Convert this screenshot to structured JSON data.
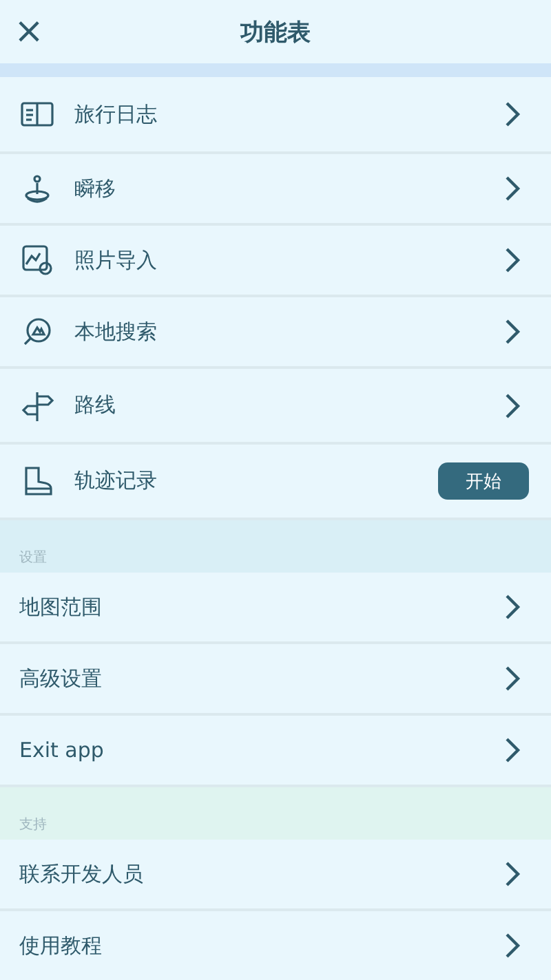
{
  "header": {
    "close": "×",
    "title": "功能表"
  },
  "features": [
    {
      "label": "旅行日志",
      "kind": "nav"
    },
    {
      "label": "瞬移",
      "kind": "nav"
    },
    {
      "label": "照片导入",
      "kind": "nav"
    },
    {
      "label": "本地搜索",
      "kind": "nav"
    },
    {
      "label": "路线",
      "kind": "nav"
    },
    {
      "label": "轨迹记录",
      "kind": "action",
      "action": "开始"
    }
  ],
  "sections": [
    {
      "title": "设置",
      "color": "#d9eff6",
      "items": [
        {
          "label": "地图范围"
        },
        {
          "label": "高级设置"
        },
        {
          "label": "Exit app"
        }
      ]
    },
    {
      "title": "支持",
      "color": "#dff4f0",
      "items": [
        {
          "label": "联系开发人员"
        },
        {
          "label": "使用教程"
        }
      ]
    }
  ]
}
